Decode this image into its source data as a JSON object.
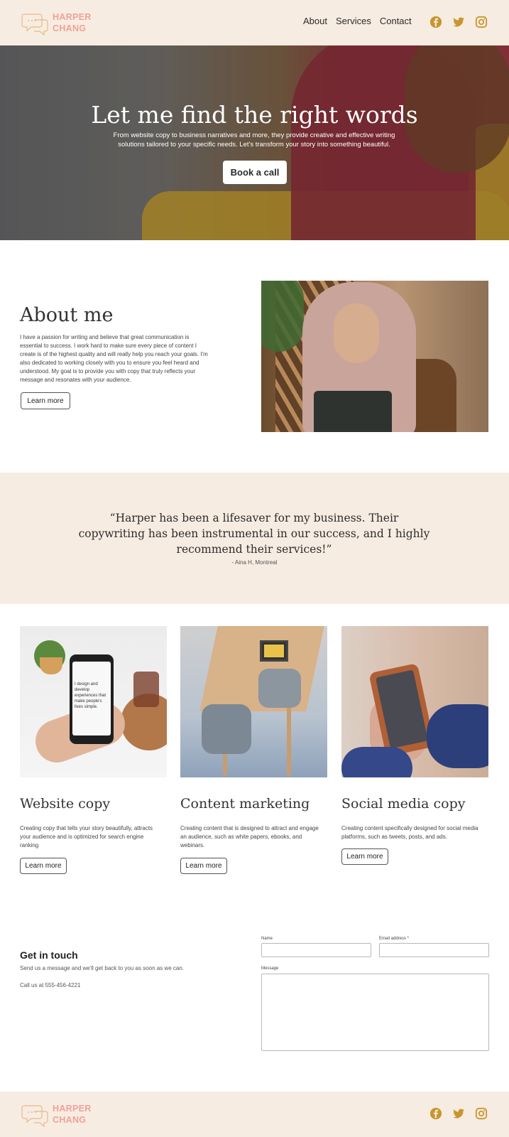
{
  "brand": {
    "line1": "HARPER",
    "line2": "CHANG",
    "color": "#f0a29a",
    "accent": "#c8962e"
  },
  "nav": {
    "items": [
      "About",
      "Services",
      "Contact"
    ]
  },
  "social_icons": [
    "facebook-icon",
    "twitter-icon",
    "instagram-icon"
  ],
  "hero": {
    "title": "Let me find the right words",
    "subtitle": "From website copy to business narratives and more, they provide creative and effective writing solutions tailored to your specific needs. Let's transform your story into something beautiful.",
    "cta": "Book a call"
  },
  "about": {
    "title": "About me",
    "text": "I have a passion for writing and believe that great communication is essential to success. I work hard to make sure every piece of content I create is of the highest quality and will really help you reach your goals. I'm also dedicated to working closely with you to ensure you feel heard and understood. My goal is to provide you with copy that truly reflects your message and resonates with your audience.",
    "button": "Learn more"
  },
  "testimonial": {
    "quote": "“Harper has been a lifesaver for my business. Their copywriting has been instrumental in our success, and I highly recommend their services!”",
    "author": "- Aina H, Montreal"
  },
  "services": [
    {
      "title": "Website copy",
      "desc": "Creating copy that tells your story beautifully, attracts your audience and is optimized for search engine ranking",
      "button": "Learn more"
    },
    {
      "title": "Content marketing",
      "desc": "Creating content that is designed to attract and engage an audience, such as white papers, ebooks, and webinars.",
      "button": "Learn more"
    },
    {
      "title": "Social media copy",
      "desc": "Creating content specifically designed for social media platforms, such as tweets, posts, and ads.",
      "button": "Learn more"
    }
  ],
  "service_image_text": "I design and develop experiences that make people's lives simple.",
  "contact": {
    "title": "Get in touch",
    "subtitle": "Send us a message and we'll get back to you as soon as we can.",
    "phone": "Call us at 555-456-4221",
    "fields": {
      "name_label": "Name",
      "email_label": "Email address *",
      "message_label": "Message"
    }
  }
}
